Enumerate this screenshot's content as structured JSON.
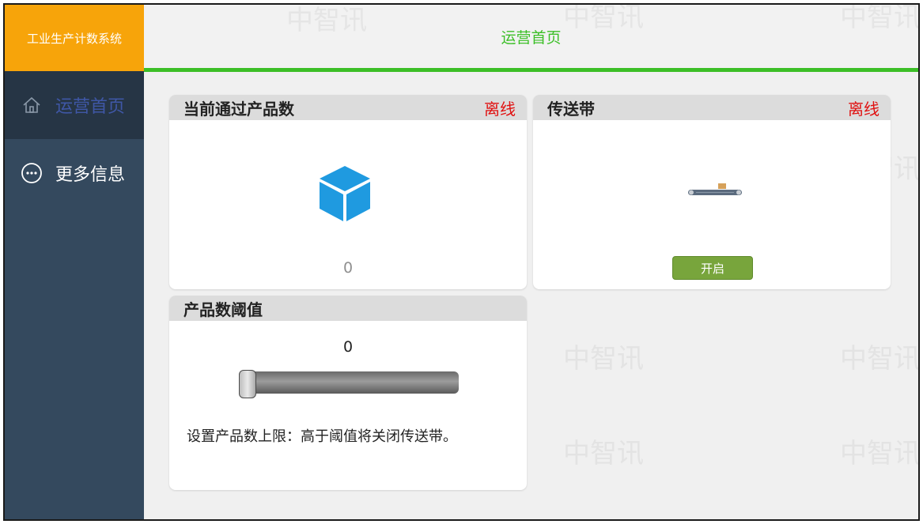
{
  "app": {
    "title": "工业生产计数系统"
  },
  "sidebar": {
    "items": [
      {
        "label": "运营首页",
        "icon": "home-icon",
        "active": true
      },
      {
        "label": "更多信息",
        "icon": "more-circle-icon",
        "active": false
      }
    ]
  },
  "topbar": {
    "title": "运营首页"
  },
  "cards": {
    "count": {
      "title": "当前通过产品数",
      "status": "离线",
      "value": "0",
      "icon": "cube-icon"
    },
    "conveyor": {
      "title": "传送带",
      "status": "离线",
      "icon": "conveyor-icon",
      "button_label": "开启"
    },
    "threshold": {
      "title": "产品数阈值",
      "value": "0",
      "slider_level": 0,
      "hint": "设置产品数上限：高于阈值将关闭传送带。"
    }
  },
  "watermark": {
    "text": "中智讯"
  },
  "colors": {
    "brand": "#f7a40a",
    "sidebar": "#34495e",
    "sidebar_active": "#263545",
    "active_label": "#3f57a6",
    "accent": "#3cbf27",
    "offline": "#e01010",
    "button": "#78a53c",
    "cube": "#1f9ae0"
  }
}
